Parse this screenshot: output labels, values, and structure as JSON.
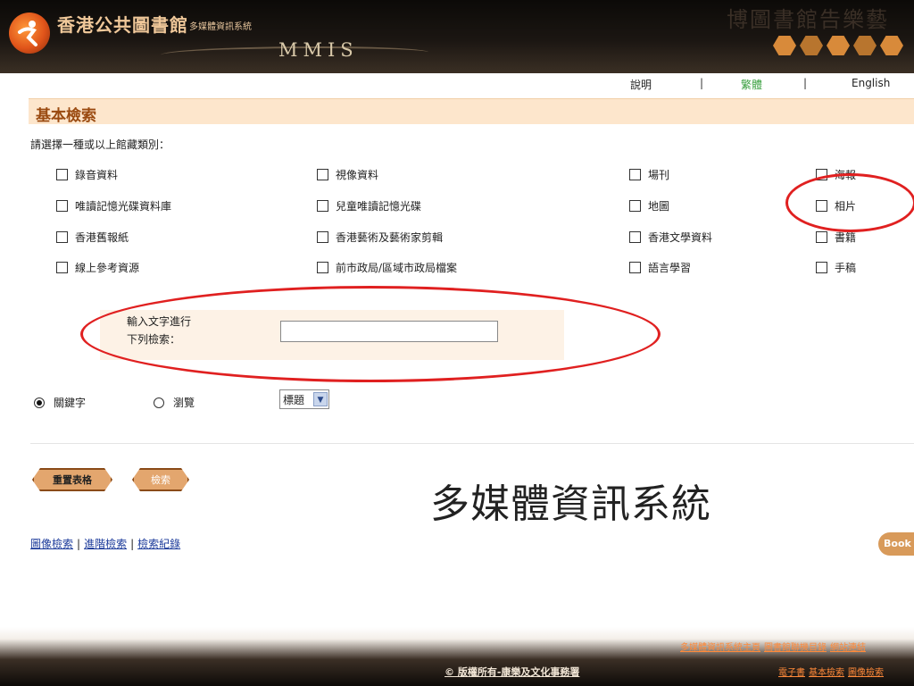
{
  "header": {
    "library_name": "香港公共圖書館",
    "system_subtitle": "多媒體資訊系統",
    "brand_code": "MMIS",
    "decor_chars": "博圖書館告樂藝"
  },
  "top_links": {
    "help": "說明",
    "separator": "|",
    "traditional": "繁體",
    "english": "English"
  },
  "page_title": "基本檢索",
  "prompt": "請選擇一種或以上館藏類別：",
  "categories": {
    "col1": [
      "錄音資料",
      "唯讀記憶光碟資料庫",
      "香港舊報紙",
      "線上參考資源"
    ],
    "col2": [
      "視像資料",
      "兒童唯讀記憶光碟",
      "香港藝術及藝術家剪輯",
      "前市政局/區域市政局檔案"
    ],
    "col3": [
      "場刊",
      "地圖",
      "香港文學資料",
      "語言學習"
    ],
    "col4": [
      "海報",
      "相片",
      "書籍",
      "手稿"
    ]
  },
  "search": {
    "label_line1": "輸入文字進行",
    "label_line2": "下列檢索：",
    "value": ""
  },
  "mode": {
    "keyword": "關鍵字",
    "browse": "瀏覽",
    "field_selected": "標題"
  },
  "buttons": {
    "reset": "重置表格",
    "search": "檢索"
  },
  "overlay_title": "多媒體資訊系統",
  "links": [
    "圖像檢索",
    "進階檢索",
    "檢索紀錄"
  ],
  "book_badge": "Book",
  "footer": {
    "links_row1": [
      "多媒體資訊系統主頁",
      "圖書館聯機目錄",
      "網站連結"
    ],
    "links_row2": [
      "電子書",
      "基本檢索",
      "圖像檢索"
    ],
    "copyright": "© 版權所有-康樂及文化事務署"
  },
  "colors": {
    "title_bar": "#fde6cc",
    "title_text": "#9a4a10",
    "link": "#1b3a9a",
    "annotation": "#e02020",
    "traditional_active": "#3aa040"
  }
}
